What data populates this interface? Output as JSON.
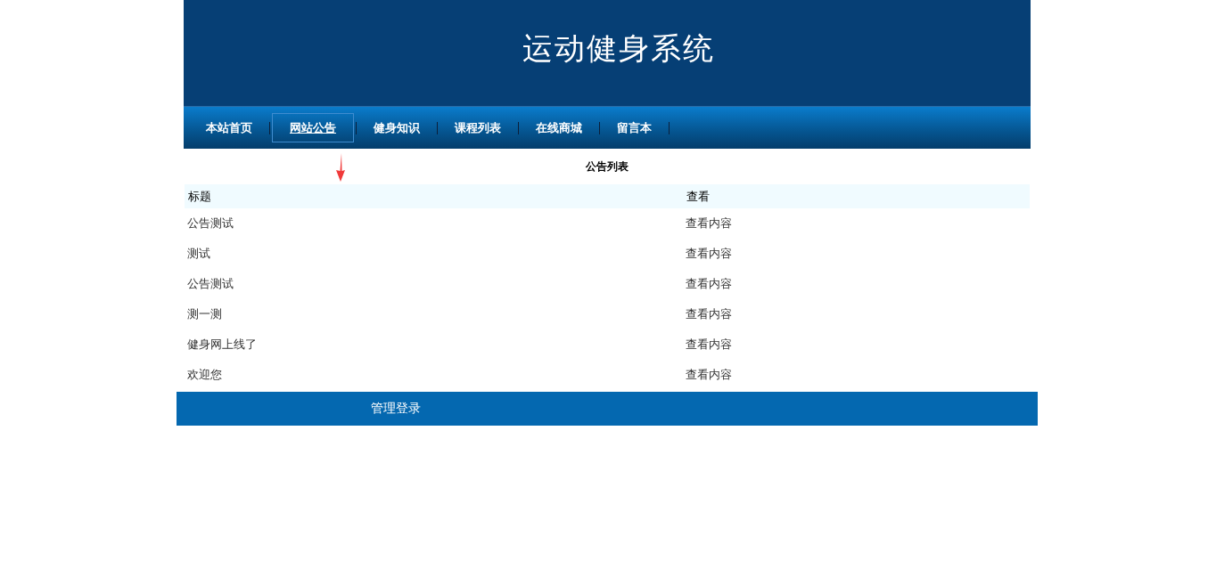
{
  "header": {
    "title": "运动健身系统"
  },
  "nav": [
    {
      "label": "本站首页",
      "selected": false
    },
    {
      "label": "网站公告",
      "selected": true
    },
    {
      "label": "健身知识",
      "selected": false
    },
    {
      "label": "课程列表",
      "selected": false
    },
    {
      "label": "在线商城",
      "selected": false
    },
    {
      "label": "留言本",
      "selected": false
    }
  ],
  "table": {
    "caption": "公告列表",
    "columns": [
      "标题",
      "查看"
    ],
    "rows": [
      [
        "公告测试",
        "查看内容"
      ],
      [
        "测试",
        "查看内容"
      ],
      [
        "公告测试",
        "查看内容"
      ],
      [
        "测一测",
        "查看内容"
      ],
      [
        "健身网上线了",
        "查看内容"
      ],
      [
        "欢迎您",
        "查看内容"
      ]
    ]
  },
  "footer": {
    "link": "管理登录"
  }
}
